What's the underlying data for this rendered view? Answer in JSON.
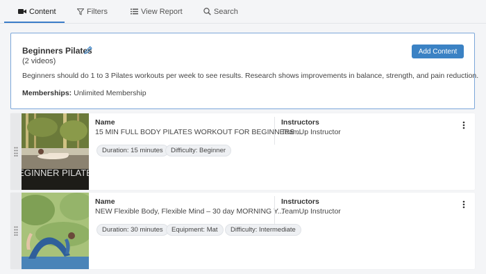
{
  "tabs": [
    {
      "label": "Content",
      "icon": "video-camera-icon",
      "active": true
    },
    {
      "label": "Filters",
      "icon": "filter-icon",
      "active": false
    },
    {
      "label": "View Report",
      "icon": "list-icon",
      "active": false
    },
    {
      "label": "Search",
      "icon": "search-icon",
      "active": false
    }
  ],
  "collection": {
    "title": "Beginners Pilates",
    "count": "(2 videos)",
    "description": "Beginners should do 1 to 3 Pilates workouts per week to see results. Research shows improvements in balance, strength, and pain reduction.",
    "memberships_label": "Memberships:",
    "memberships_value": "Unlimited Membership",
    "add_button": "Add Content"
  },
  "labels": {
    "name": "Name",
    "instructors": "Instructors"
  },
  "videos": [
    {
      "name": "15 MIN FULL BODY PILATES WORKOUT FOR BEGINNERS ...",
      "instructor": "TeamUp Instructor",
      "thumb_text": "BEGINNER PILATES",
      "tags": [
        "Duration: 15 minutes",
        "Difficulty: Beginner"
      ]
    },
    {
      "name": "NEW Flexible Body, Flexible Mind – 30 day MORNING Y...",
      "instructor": "TeamUp Instructor",
      "tags": [
        "Duration: 30 minutes",
        "Equipment: Mat",
        "Difficulty: Intermediate"
      ]
    }
  ],
  "colors": {
    "accent": "#3b82c4",
    "panel_border": "#7ba6d9",
    "background": "#f4f5f7"
  }
}
